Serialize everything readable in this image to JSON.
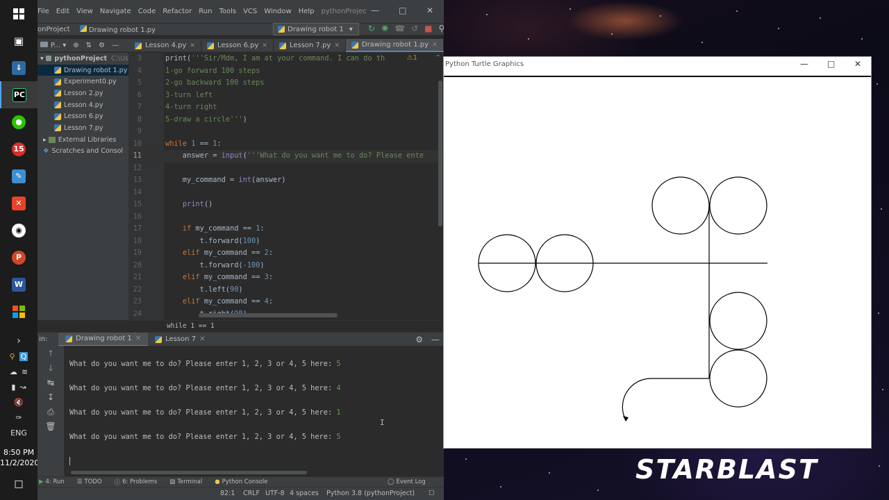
{
  "ide": {
    "menu": [
      "File",
      "Edit",
      "View",
      "Navigate",
      "Code",
      "Refactor",
      "Run",
      "Tools",
      "VCS",
      "Window",
      "Help",
      "pythonProjec"
    ],
    "breadcrumbs": [
      "onProject",
      "Drawing robot 1.py"
    ],
    "run_config": "Drawing robot 1",
    "project_header": "P...",
    "tabs": [
      "Lesson 4.py",
      "Lesson 6.py",
      "Lesson 7.py",
      "Drawing robot 1.py"
    ],
    "tree": {
      "root": "pythonProject",
      "root_path": "C:\\Us",
      "files": [
        "Drawing robot 1.py",
        "Experiment0.py",
        "Lesson 2.py",
        "Lesson 4.py",
        "Lesson 6.py",
        "Lesson 7.py"
      ],
      "external": "External Libraries",
      "scratches": "Scratches and Consol"
    },
    "editor": {
      "warning_count": "1",
      "breadcrumb": "while 1 == 1"
    },
    "run": {
      "label": "in:",
      "tabs": [
        "Drawing robot 1",
        "Lesson 7"
      ],
      "prompt": "What do you want me to do? Please enter 1, 2, 3 or 4, 5 here: ",
      "inputs": [
        "5",
        "4",
        "1",
        "5"
      ]
    },
    "bottom_tools": [
      "4: Run",
      "TODO",
      "6: Problems",
      "Terminal",
      "Python Console",
      "Event Log"
    ],
    "status": {
      "position": "82:1",
      "line_sep": "CRLF",
      "encoding": "UTF-8",
      "indent": "4 spaces",
      "interpreter": "Python 3.8 (pythonProject)"
    }
  },
  "code_lines": [
    {
      "n": "3",
      "segs": [
        {
          "t": "print(",
          "c": ""
        },
        {
          "t": "'''Sir/Mdm, I am at your command. I can do th",
          "c": "str"
        }
      ]
    },
    {
      "n": "4",
      "segs": [
        {
          "t": "1-go forward 100 steps",
          "c": "str"
        }
      ]
    },
    {
      "n": "5",
      "segs": [
        {
          "t": "2-go backward 100 steps",
          "c": "str"
        }
      ]
    },
    {
      "n": "6",
      "segs": [
        {
          "t": "3-turn left",
          "c": "str"
        }
      ]
    },
    {
      "n": "7",
      "segs": [
        {
          "t": "4-turn right",
          "c": "str"
        }
      ]
    },
    {
      "n": "8",
      "segs": [
        {
          "t": "5-draw a circle'''",
          "c": "str"
        },
        {
          "t": ")",
          "c": ""
        }
      ]
    },
    {
      "n": "9",
      "segs": []
    },
    {
      "n": "10",
      "segs": [
        {
          "t": "while ",
          "c": "kw"
        },
        {
          "t": "1",
          "c": "numl"
        },
        {
          "t": " == ",
          "c": ""
        },
        {
          "t": "1",
          "c": "numl"
        },
        {
          "t": ":",
          "c": ""
        }
      ]
    },
    {
      "n": "11",
      "segs": [
        {
          "t": "    answer = ",
          "c": ""
        },
        {
          "t": "input",
          "c": "fn"
        },
        {
          "t": "(",
          "c": ""
        },
        {
          "t": "'''What do you want me to do? Please ente",
          "c": "str"
        }
      ]
    },
    {
      "n": "12",
      "segs": []
    },
    {
      "n": "13",
      "segs": [
        {
          "t": "    my_command = ",
          "c": ""
        },
        {
          "t": "int",
          "c": "fn"
        },
        {
          "t": "(answer)",
          "c": ""
        }
      ]
    },
    {
      "n": "14",
      "segs": []
    },
    {
      "n": "15",
      "segs": [
        {
          "t": "    ",
          "c": ""
        },
        {
          "t": "print",
          "c": "fn"
        },
        {
          "t": "()",
          "c": ""
        }
      ]
    },
    {
      "n": "16",
      "segs": []
    },
    {
      "n": "17",
      "segs": [
        {
          "t": "    ",
          "c": ""
        },
        {
          "t": "if ",
          "c": "kw"
        },
        {
          "t": "my_command == ",
          "c": ""
        },
        {
          "t": "1",
          "c": "numl"
        },
        {
          "t": ":",
          "c": ""
        }
      ]
    },
    {
      "n": "18",
      "segs": [
        {
          "t": "        t.forward(",
          "c": ""
        },
        {
          "t": "100",
          "c": "numl"
        },
        {
          "t": ")",
          "c": ""
        }
      ]
    },
    {
      "n": "19",
      "segs": [
        {
          "t": "    ",
          "c": ""
        },
        {
          "t": "elif ",
          "c": "kw"
        },
        {
          "t": "my_command == ",
          "c": ""
        },
        {
          "t": "2",
          "c": "numl"
        },
        {
          "t": ":",
          "c": ""
        }
      ]
    },
    {
      "n": "20",
      "segs": [
        {
          "t": "        t.forward(",
          "c": ""
        },
        {
          "t": "-100",
          "c": "numl"
        },
        {
          "t": ")",
          "c": ""
        }
      ]
    },
    {
      "n": "21",
      "segs": [
        {
          "t": "    ",
          "c": ""
        },
        {
          "t": "elif ",
          "c": "kw"
        },
        {
          "t": "my_command == ",
          "c": ""
        },
        {
          "t": "3",
          "c": "numl"
        },
        {
          "t": ":",
          "c": ""
        }
      ]
    },
    {
      "n": "22",
      "segs": [
        {
          "t": "        t.left(",
          "c": ""
        },
        {
          "t": "90",
          "c": "numl"
        },
        {
          "t": ")",
          "c": ""
        }
      ]
    },
    {
      "n": "23",
      "segs": [
        {
          "t": "    ",
          "c": ""
        },
        {
          "t": "elif ",
          "c": "kw"
        },
        {
          "t": "my_command == ",
          "c": ""
        },
        {
          "t": "4",
          "c": "numl"
        },
        {
          "t": ":",
          "c": ""
        }
      ]
    },
    {
      "n": "24",
      "segs": [
        {
          "t": "        t.right(",
          "c": ""
        },
        {
          "t": "90",
          "c": "numl"
        },
        {
          "t": ")",
          "c": ""
        }
      ]
    }
  ],
  "turtle": {
    "title": "Python Turtle Graphics"
  },
  "taskbar": {
    "lang": "ENG",
    "time": "8:50 PM",
    "date": "11/2/2020",
    "badge": "15"
  },
  "wallpaper": {
    "logo": "STARBLAST"
  }
}
